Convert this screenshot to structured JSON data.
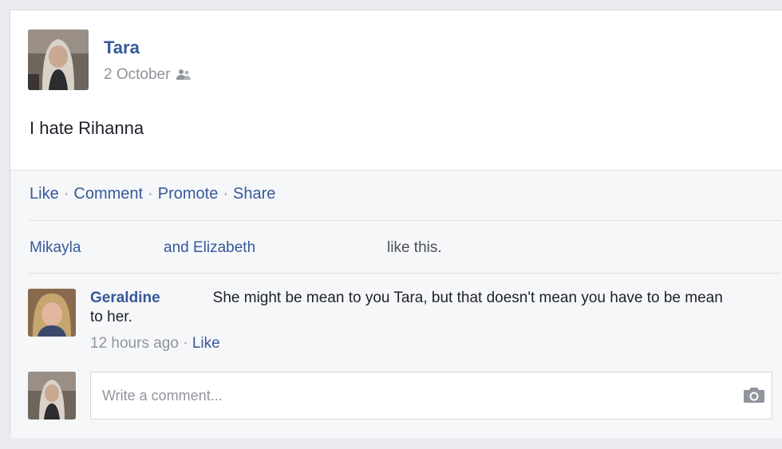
{
  "post": {
    "author": "Tara",
    "date": "2 October",
    "privacy_icon": "friends-icon",
    "text": "I hate Rihanna"
  },
  "actions": {
    "like": "Like",
    "comment": "Comment",
    "promote": "Promote",
    "share": "Share",
    "separator": "·"
  },
  "likes": {
    "first": "Mikayla",
    "second": "and Elizabeth",
    "suffix": "like this."
  },
  "comment": {
    "author": "Geraldine",
    "text": "She might be mean to you Tara, but that doesn't mean you have to be mean to her.",
    "time": "12 hours ago",
    "separator": "·",
    "like": "Like"
  },
  "composer": {
    "placeholder": "Write a comment...",
    "camera_icon": "camera-icon"
  },
  "colors": {
    "link": "#365899",
    "meta": "#90949c",
    "background": "#e9ebee"
  }
}
